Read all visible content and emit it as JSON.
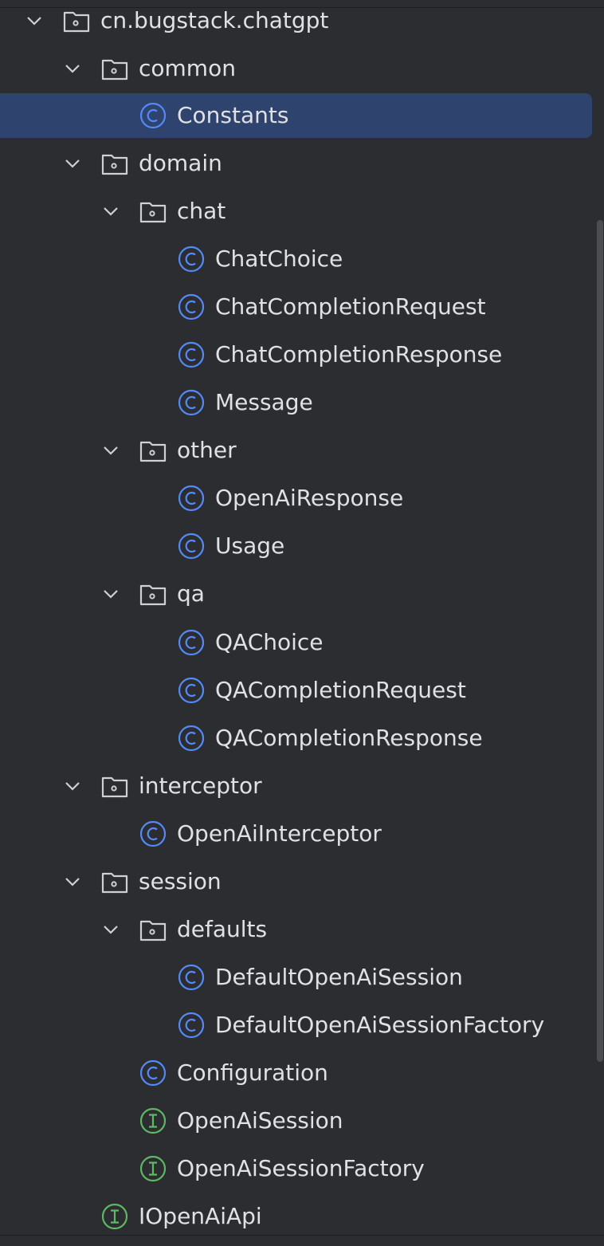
{
  "project_tree": {
    "items": [
      {
        "label": "cn.bugstack.chatgpt",
        "kind": "package",
        "expanded": true
      },
      {
        "label": "common",
        "kind": "package",
        "expanded": true
      },
      {
        "label": "Constants",
        "kind": "class",
        "selected": true
      },
      {
        "label": "domain",
        "kind": "package",
        "expanded": true
      },
      {
        "label": "chat",
        "kind": "package",
        "expanded": true
      },
      {
        "label": "ChatChoice",
        "kind": "class"
      },
      {
        "label": "ChatCompletionRequest",
        "kind": "class"
      },
      {
        "label": "ChatCompletionResponse",
        "kind": "class"
      },
      {
        "label": "Message",
        "kind": "class"
      },
      {
        "label": "other",
        "kind": "package",
        "expanded": true
      },
      {
        "label": "OpenAiResponse",
        "kind": "class"
      },
      {
        "label": "Usage",
        "kind": "class"
      },
      {
        "label": "qa",
        "kind": "package",
        "expanded": true
      },
      {
        "label": "QAChoice",
        "kind": "class"
      },
      {
        "label": "QACompletionRequest",
        "kind": "class"
      },
      {
        "label": "QACompletionResponse",
        "kind": "class"
      },
      {
        "label": "interceptor",
        "kind": "package",
        "expanded": true
      },
      {
        "label": "OpenAiInterceptor",
        "kind": "class"
      },
      {
        "label": "session",
        "kind": "package",
        "expanded": true
      },
      {
        "label": "defaults",
        "kind": "package",
        "expanded": true
      },
      {
        "label": "DefaultOpenAiSession",
        "kind": "class"
      },
      {
        "label": "DefaultOpenAiSessionFactory",
        "kind": "class"
      },
      {
        "label": "Configuration",
        "kind": "class"
      },
      {
        "label": "OpenAiSession",
        "kind": "interface"
      },
      {
        "label": "OpenAiSessionFactory",
        "kind": "interface"
      },
      {
        "label": "IOpenAiApi",
        "kind": "interface"
      }
    ]
  },
  "colors": {
    "background": "#2b2d30",
    "selection": "#2e436e",
    "text": "#dfe1e5",
    "class_icon": "#548af7",
    "interface_icon": "#5fb865",
    "folder_icon": "#ced0d6",
    "chevron": "#ced0d6"
  }
}
